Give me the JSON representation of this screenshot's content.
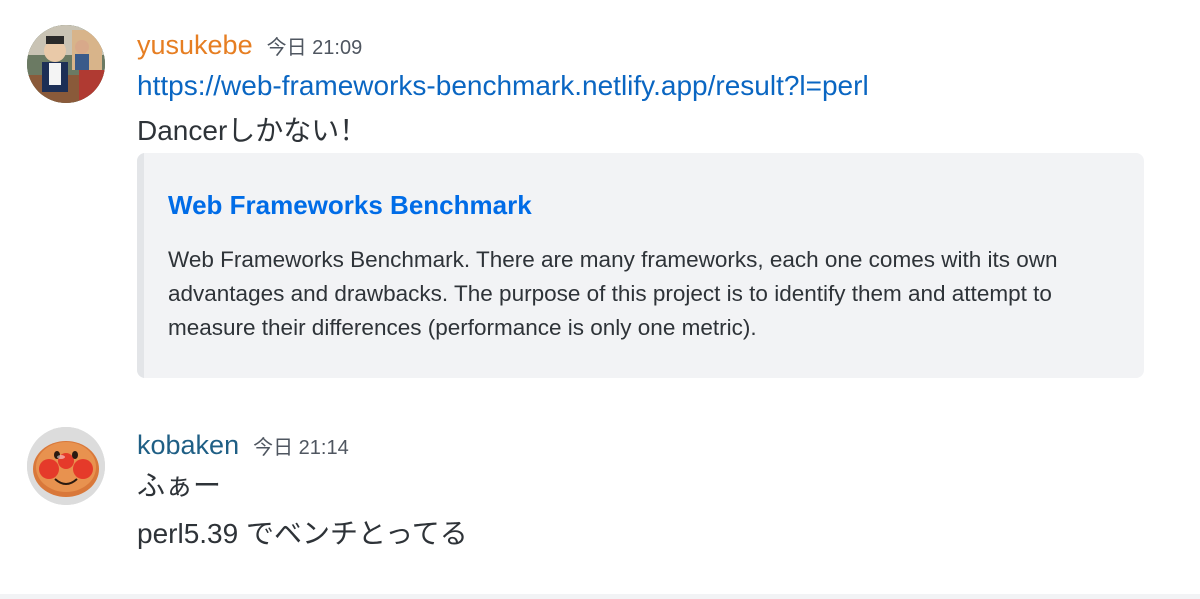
{
  "messages": [
    {
      "username": "yusukebe",
      "timestamp": "今日 21:09",
      "link": "https://web-frameworks-benchmark.netlify.app/result?l=perl",
      "text": "Dancerしかない！",
      "embed": {
        "title": "Web Frameworks Benchmark",
        "description": "Web Frameworks Benchmark. There are many frameworks, each one comes with its own advantages and drawbacks. The purpose of this project is to identify them and attempt to measure their differences (performance is only one metric)."
      }
    },
    {
      "username": "kobaken",
      "timestamp": "今日 21:14",
      "lines": [
        "ふぁー",
        "perl5.39 でベンチとってる"
      ]
    }
  ],
  "colors": {
    "yusukebe_name": "#e67e22",
    "kobaken_name": "#1f5f85",
    "link": "#0a66c2",
    "embed_title": "#006ce7",
    "embed_bg": "#f2f3f5"
  }
}
